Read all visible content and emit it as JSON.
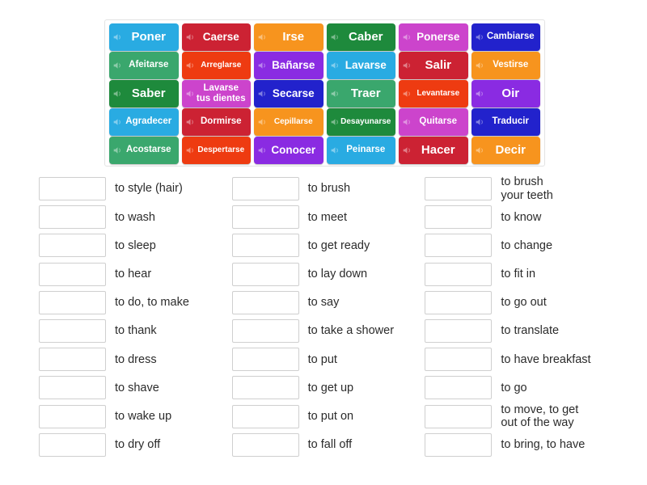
{
  "activity": {
    "type": "match-up-vocabulary",
    "title": "Spanish reflexive and common verbs matching activity"
  },
  "tile_panel": {
    "icon": "speaker-icon",
    "rows": [
      [
        {
          "label": "Poner",
          "color": "#29abe2"
        },
        {
          "label": "Caerse",
          "color": "#cc2233"
        },
        {
          "label": "Irse",
          "color": "#f7941e"
        },
        {
          "label": "Caber",
          "color": "#1e8a3c"
        },
        {
          "label": "Ponerse",
          "color": "#cc44cc"
        },
        {
          "label": "Cambiarse",
          "color": "#2222cc"
        }
      ],
      [
        {
          "label": "Afeitarse",
          "color": "#3aa76d"
        },
        {
          "label": "Arreglarse",
          "color": "#ee3b11"
        },
        {
          "label": "Bañarse",
          "color": "#8a2be2"
        },
        {
          "label": "Lavarse",
          "color": "#29abe2"
        },
        {
          "label": "Salir",
          "color": "#cc2233"
        },
        {
          "label": "Vestirse",
          "color": "#f7941e"
        }
      ],
      [
        {
          "label": "Saber",
          "color": "#1e8a3c"
        },
        {
          "label": "Lavarse\ntus dientes",
          "color": "#cc44cc"
        },
        {
          "label": "Secarse",
          "color": "#2222cc"
        },
        {
          "label": "Traer",
          "color": "#3aa76d"
        },
        {
          "label": "Levantarse",
          "color": "#ee3b11"
        },
        {
          "label": "Oir",
          "color": "#8a2be2"
        }
      ],
      [
        {
          "label": "Agradecer",
          "color": "#29abe2"
        },
        {
          "label": "Dormirse",
          "color": "#cc2233"
        },
        {
          "label": "Cepillarse",
          "color": "#f7941e"
        },
        {
          "label": "Desayunarse",
          "color": "#1e8a3c"
        },
        {
          "label": "Quitarse",
          "color": "#cc44cc"
        },
        {
          "label": "Traducir",
          "color": "#2222cc"
        }
      ],
      [
        {
          "label": "Acostarse",
          "color": "#3aa76d"
        },
        {
          "label": "Despertarse",
          "color": "#ee3b11"
        },
        {
          "label": "Conocer",
          "color": "#8a2be2"
        },
        {
          "label": "Peinarse",
          "color": "#29abe2"
        },
        {
          "label": "Hacer",
          "color": "#cc2233"
        },
        {
          "label": "Decir",
          "color": "#f7941e"
        }
      ]
    ]
  },
  "answers": {
    "input_value": "",
    "input_placeholder": "",
    "items": [
      {
        "text": "to style (hair)"
      },
      {
        "text": "to brush"
      },
      {
        "text": "to brush\nyour teeth"
      },
      {
        "text": "to wash"
      },
      {
        "text": "to meet"
      },
      {
        "text": "to know"
      },
      {
        "text": "to sleep"
      },
      {
        "text": "to get ready"
      },
      {
        "text": "to change"
      },
      {
        "text": "to hear"
      },
      {
        "text": "to lay down"
      },
      {
        "text": "to fit in"
      },
      {
        "text": "to do, to make"
      },
      {
        "text": "to say"
      },
      {
        "text": "to go out"
      },
      {
        "text": "to thank"
      },
      {
        "text": "to take a shower"
      },
      {
        "text": "to translate"
      },
      {
        "text": "to dress"
      },
      {
        "text": "to put"
      },
      {
        "text": "to have breakfast"
      },
      {
        "text": "to shave"
      },
      {
        "text": "to get up"
      },
      {
        "text": "to go"
      },
      {
        "text": "to wake up"
      },
      {
        "text": "to put on"
      },
      {
        "text": "to move, to get\nout of the way"
      },
      {
        "text": "to dry off"
      },
      {
        "text": "to fall off"
      },
      {
        "text": "to bring, to have"
      }
    ]
  },
  "colors": {
    "panel_border": "#e3e3e3",
    "input_border": "#cfcfcf",
    "text": "#2b2b2b",
    "tile_text": "#ffffff"
  }
}
